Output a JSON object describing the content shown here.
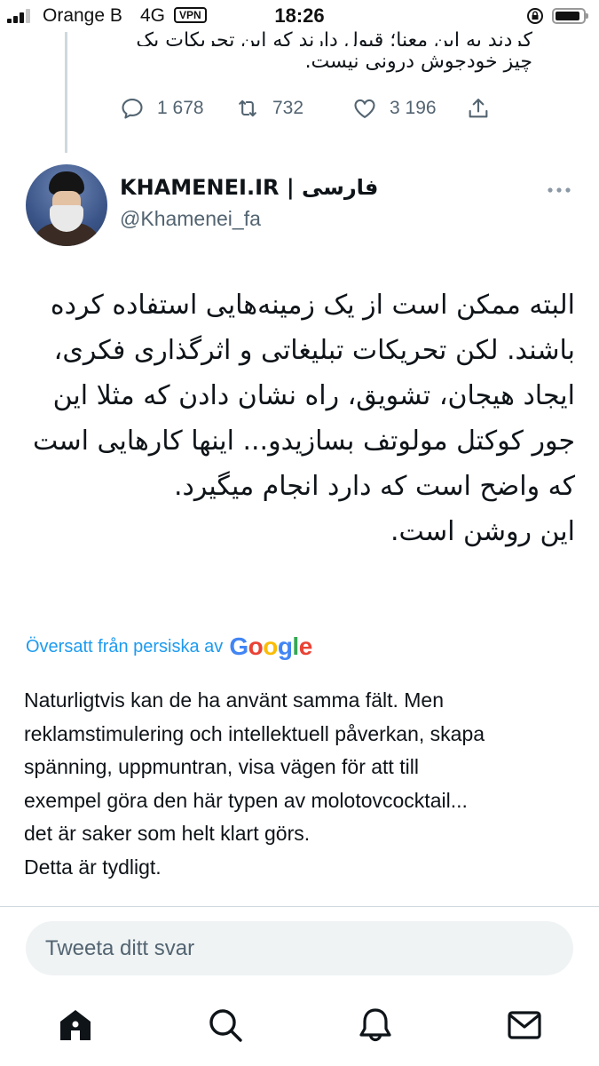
{
  "status_bar": {
    "carrier": "Orange B",
    "network": "4G",
    "vpn": "VPN",
    "time": "18:26",
    "battery_level": 0.9,
    "signal_bars_filled": 3
  },
  "previous_tweet": {
    "text_line1": "کردند به این معنا؛ قبول دارند که این تحریکات یک",
    "text_line2": "چیز خودجوش درونی نیست.",
    "replies": "1 678",
    "retweets": "732",
    "likes": "3 196"
  },
  "tweet": {
    "author_name": "KHAMENEI.IR | فارسی",
    "author_handle": "@Khamenei_fa",
    "text_fa": "البته ممکن است از یک زمینه‌هایی استفاده کرده باشند. لکن تحریکات تبلیغاتی و اثرگذاری فکری، ایجاد هیجان، تشویق، راه نشان دادن که مثلا این جور کوکتل مولوتف بسازیدو... اینها کارهایی است که واضح است که دارد انجام میگیرد.",
    "text_fa_last": "این روشن است.",
    "translated_label": "Översatt från persiska av",
    "google": "Google",
    "text_sv_lines": [
      "Naturligtvis kan de ha använt samma fält. Men",
      "reklamstimulering och intellektuell påverkan, skapa",
      "spänning, uppmuntran, visa vägen för att till",
      "exempel göra den här typen av molotovcocktail...",
      "det är saker som helt klart görs.",
      "Detta är tydligt."
    ]
  },
  "reply": {
    "placeholder": "Tweeta ditt svar"
  },
  "colors": {
    "accent": "#1d9bf0",
    "text_primary": "#0f1419",
    "text_secondary": "#536471",
    "reply_bg": "#eff3f4",
    "divider": "#cfd9de"
  },
  "icons": {
    "tabs": [
      "home-icon",
      "search-icon",
      "notifications-icon",
      "messages-icon"
    ]
  }
}
